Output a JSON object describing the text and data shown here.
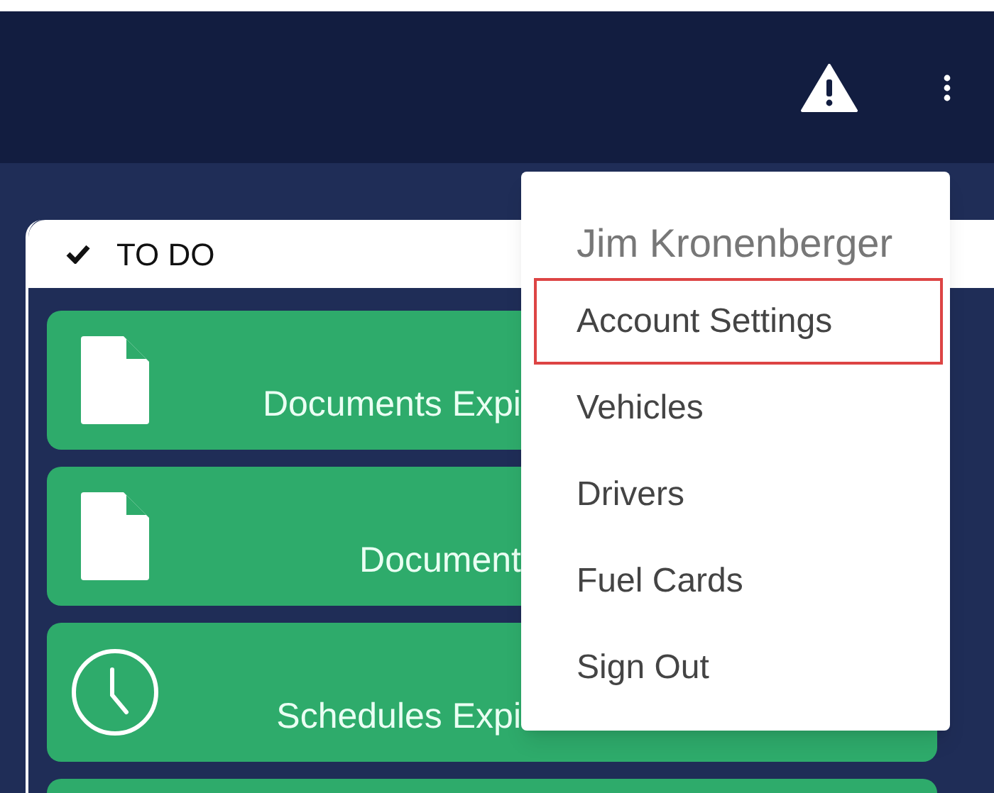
{
  "todo_panel": {
    "title": "TO DO",
    "cards": [
      {
        "kind": "document",
        "label": "Documents Expi"
      },
      {
        "kind": "document",
        "label": "Document"
      },
      {
        "kind": "schedule",
        "label": "Schedules Expi"
      },
      {
        "kind": "blank"
      }
    ]
  },
  "user_menu": {
    "user_name": "Jim Kronenberger",
    "items": [
      {
        "label": "Account Settings",
        "selected": true
      },
      {
        "label": "Vehicles",
        "selected": false
      },
      {
        "label": "Drivers",
        "selected": false
      },
      {
        "label": "Fuel Cards",
        "selected": false
      },
      {
        "label": "Sign Out",
        "selected": false
      }
    ]
  }
}
